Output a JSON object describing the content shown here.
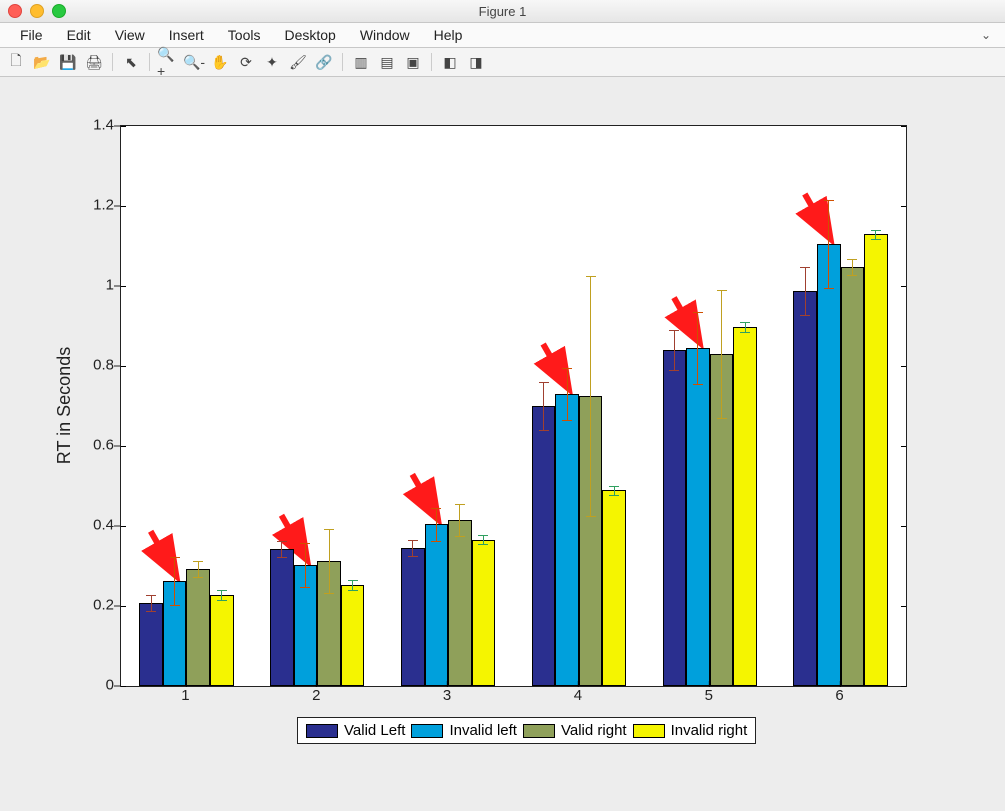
{
  "window": {
    "title": "Figure 1"
  },
  "menus": {
    "items": [
      "File",
      "Edit",
      "View",
      "Insert",
      "Tools",
      "Desktop",
      "Window",
      "Help"
    ],
    "chevron": "⌄"
  },
  "toolbar": {
    "icons": [
      {
        "name": "new-file-icon",
        "glyph": "🗋"
      },
      {
        "name": "open-file-icon",
        "glyph": "📂"
      },
      {
        "name": "save-icon",
        "glyph": "💾"
      },
      {
        "name": "print-icon",
        "glyph": "🖨"
      },
      {
        "sep": true
      },
      {
        "name": "pointer-icon",
        "glyph": "⬉"
      },
      {
        "sep": true
      },
      {
        "name": "zoom-in-icon",
        "glyph": "🔍+"
      },
      {
        "name": "zoom-out-icon",
        "glyph": "🔍-"
      },
      {
        "name": "pan-icon",
        "glyph": "✋"
      },
      {
        "name": "rotate-icon",
        "glyph": "⟳"
      },
      {
        "name": "data-cursor-icon",
        "glyph": "✦"
      },
      {
        "name": "brush-icon",
        "glyph": "🖌"
      },
      {
        "name": "link-icon",
        "glyph": "🔗"
      },
      {
        "sep": true
      },
      {
        "name": "colorbar-icon",
        "glyph": "▥"
      },
      {
        "name": "legend-icon",
        "glyph": "▤"
      },
      {
        "name": "insert-icon",
        "glyph": "▣"
      },
      {
        "sep": true
      },
      {
        "name": "hide-plot-tools-icon",
        "glyph": "◧"
      },
      {
        "name": "show-plot-tools-icon",
        "glyph": "◨"
      }
    ]
  },
  "chart_data": {
    "type": "bar",
    "ylabel": "RT in Seconds",
    "xlabel": "",
    "categories": [
      "1",
      "2",
      "3",
      "4",
      "5",
      "6"
    ],
    "ylim": [
      0,
      1.4
    ],
    "yticks": [
      0,
      0.2,
      0.4,
      0.6,
      0.8,
      1.0,
      1.2,
      1.4
    ],
    "colors": {
      "valid_left": "#2a2f8f",
      "invalid_left": "#00a0dc",
      "valid_right": "#8fa05a",
      "invalid_right": "#f5f500"
    },
    "series": [
      {
        "name": "Valid Left",
        "key": "valid_left",
        "values": [
          0.207,
          0.343,
          0.345,
          0.7,
          0.84,
          0.987
        ],
        "errors": [
          0.02,
          0.02,
          0.02,
          0.06,
          0.05,
          0.06
        ]
      },
      {
        "name": "Invalid left",
        "key": "invalid_left",
        "values": [
          0.262,
          0.302,
          0.404,
          0.73,
          0.846,
          1.105
        ],
        "errors": [
          0.06,
          0.055,
          0.042,
          0.065,
          0.09,
          0.11
        ]
      },
      {
        "name": "Valid right",
        "key": "valid_right",
        "values": [
          0.293,
          0.312,
          0.416,
          0.724,
          0.83,
          1.048
        ],
        "errors": [
          0.02,
          0.08,
          0.04,
          0.3,
          0.16,
          0.02
        ]
      },
      {
        "name": "Invalid right",
        "key": "invalid_right",
        "values": [
          0.228,
          0.252,
          0.366,
          0.489,
          0.898,
          1.129
        ],
        "errors": [
          0.012,
          0.012,
          0.012,
          0.012,
          0.012,
          0.012
        ]
      }
    ],
    "legend": [
      "Valid Left",
      "Invalid left",
      "Valid right",
      "Invalid right"
    ],
    "annotations": [
      {
        "type": "arrow",
        "group": 1
      },
      {
        "type": "arrow",
        "group": 2
      },
      {
        "type": "arrow",
        "group": 3
      },
      {
        "type": "arrow",
        "group": 4
      },
      {
        "type": "arrow",
        "group": 5
      },
      {
        "type": "arrow",
        "group": 6
      }
    ]
  }
}
